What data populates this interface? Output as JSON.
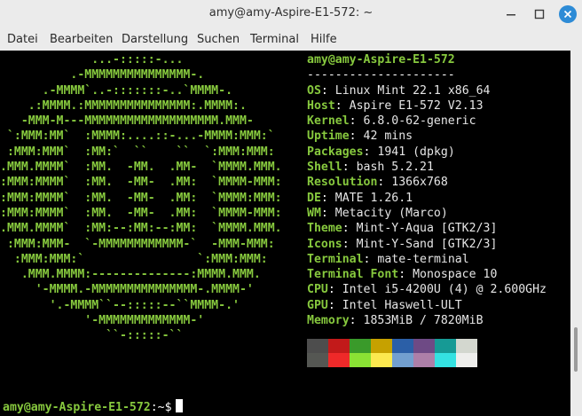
{
  "window": {
    "title": "amy@amy-Aspire-E1-572: ~",
    "controls": {
      "minimize": "minimize-icon",
      "maximize": "maximize-icon",
      "close": "close-icon"
    }
  },
  "menu": [
    "Datei",
    "Bearbeiten",
    "Darstellung",
    "Suchen",
    "Terminal",
    "Hilfe"
  ],
  "colors": {
    "green": "#87c93e",
    "white": "#ffffff",
    "terminal_bg": "#000000",
    "close_button": "#2d8bd6"
  },
  "terminal": {
    "logo_lines": [
      "             ...-:::::-...",
      "          .-MMMMMMMMMMMMMMM-.",
      "      .-MMMM`..-:::::::-..`MMMM-.",
      "    .:MMMM.:MMMMMMMMMMMMMMM:.MMMM:.",
      "   -MMM-M---MMMMMMMMMMMMMMMMMMM.MMM-",
      " `:MMM:MM`  :MMMM:....::-...-MMMM:MMM:`",
      " :MMM:MMM`  :MM:`  ``    ``  `:MMM:MMM:",
      ".MMM.MMMM`  :MM.  -MM.  .MM-  `MMMM.MMM.",
      ":MMM:MMMM`  :MM.  -MM-  .MM:  `MMMM-MMM:",
      ":MMM:MMMM`  :MM.  -MM-  .MM:  `MMMM:MMM:",
      ":MMM:MMMM`  :MM.  -MM-  .MM:  `MMMM-MMM:",
      ".MMM.MMMM`  :MM:--:MM:--:MM:  `MMMM.MMM.",
      " :MMM:MMM-  `-MMMMMMMMMMMM-`  -MMM-MMM:",
      "  :MMM:MMM:`                `:MMM:MMM:",
      "   .MMM.MMMM:--------------:MMMM.MMM.",
      "     '-MMMM.-MMMMMMMMMMMMMMM-.MMMM-'",
      "       '.-MMMM``--:::::--``MMMM-.'",
      "            '-MMMMMMMMMMMMM-'",
      "               ``-:::::-``"
    ],
    "user_host": "amy@amy-Aspire-E1-572",
    "separator": "---------------------",
    "info": [
      {
        "key": "OS",
        "value": "Linux Mint 22.1 x86_64"
      },
      {
        "key": "Host",
        "value": "Aspire E1-572 V2.13"
      },
      {
        "key": "Kernel",
        "value": "6.8.0-62-generic"
      },
      {
        "key": "Uptime",
        "value": "42 mins"
      },
      {
        "key": "Packages",
        "value": "1941 (dpkg)"
      },
      {
        "key": "Shell",
        "value": "bash 5.2.21"
      },
      {
        "key": "Resolution",
        "value": "1366x768"
      },
      {
        "key": "DE",
        "value": "MATE 1.26.1"
      },
      {
        "key": "WM",
        "value": "Metacity (Marco)"
      },
      {
        "key": "Theme",
        "value": "Mint-Y-Aqua [GTK2/3]"
      },
      {
        "key": "Icons",
        "value": "Mint-Y-Sand [GTK2/3]"
      },
      {
        "key": "Terminal",
        "value": "mate-terminal"
      },
      {
        "key": "Terminal Font",
        "value": "Monospace 10"
      },
      {
        "key": "CPU",
        "value": "Intel i5-4200U (4) @ 2.600GHz"
      },
      {
        "key": "GPU",
        "value": "Intel Haswell-ULT"
      },
      {
        "key": "Memory",
        "value": "1853MiB / 7820MiB"
      }
    ],
    "palette_row1": [
      "#4d4d4d",
      "#c21a1a",
      "#3a9a2a",
      "#c6a100",
      "#2b5fa7",
      "#6e4a85",
      "#169a95",
      "#d3d7cf"
    ],
    "palette_row2": [
      "#555753",
      "#ef2929",
      "#8ae234",
      "#fce94f",
      "#729fcf",
      "#ad7fa8",
      "#34e2e2",
      "#eeeeec"
    ],
    "prompt": {
      "user_host": "amy@amy-Aspire-E1-572",
      "path": ":~",
      "symbol": "$"
    }
  }
}
